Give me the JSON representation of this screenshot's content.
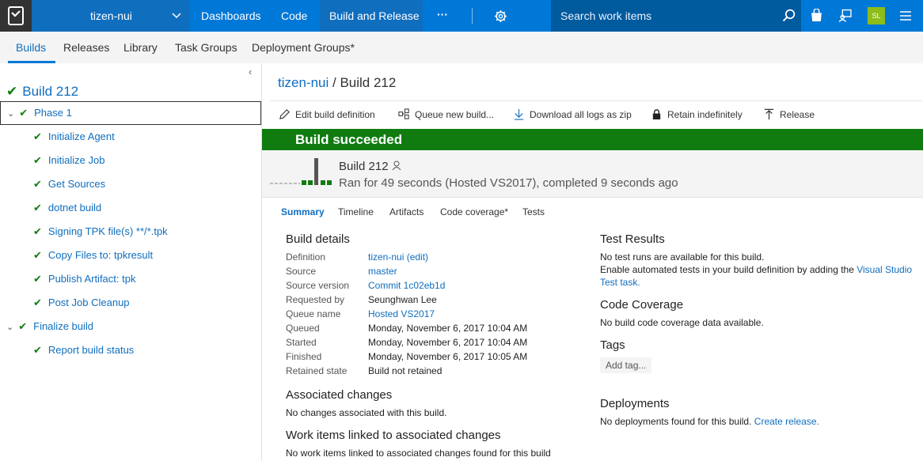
{
  "topbar": {
    "project": "tizen-nui",
    "nav": [
      "Dashboards",
      "Code",
      "Build and Release"
    ],
    "more": "···",
    "search_placeholder": "Search work items",
    "avatar_initials": "SL"
  },
  "hubs": [
    "Builds",
    "Releases",
    "Library",
    "Task Groups",
    "Deployment Groups*"
  ],
  "tree": {
    "root": "Build 212",
    "phase": "Phase 1",
    "steps": [
      "Initialize Agent",
      "Initialize Job",
      "Get Sources",
      "dotnet build",
      "Signing TPK file(s) **/*.tpk",
      "Copy Files to: tpkresult",
      "Publish Artifact: tpk",
      "Post Job Cleanup"
    ],
    "finalize": "Finalize build",
    "final_steps": [
      "Report build status"
    ]
  },
  "breadcrumb": {
    "project": "tizen-nui",
    "sep": " / ",
    "build": "Build 212"
  },
  "toolbar": [
    "Edit build definition",
    "Queue new build...",
    "Download all logs as zip",
    "Retain indefinitely",
    "Release"
  ],
  "banner": "Build succeeded",
  "summary": {
    "build": "Build 212",
    "meta": "Ran for 49 seconds (Hosted VS2017), completed 9 seconds ago"
  },
  "tabs": [
    "Summary",
    "Timeline",
    "Artifacts",
    "Code coverage*",
    "Tests"
  ],
  "build_details": {
    "title": "Build details",
    "rows": [
      {
        "label": "Definition",
        "value": "tizen-nui (edit)"
      },
      {
        "label": "Source",
        "value": "master"
      },
      {
        "label": "Source version",
        "value": "Commit 1c02eb1d"
      },
      {
        "label": "Requested by",
        "value": "Seunghwan Lee"
      },
      {
        "label": "Queue name",
        "value": "Hosted VS2017"
      },
      {
        "label": "Queued",
        "value": "Monday, November 6, 2017 10:04 AM"
      },
      {
        "label": "Started",
        "value": "Monday, November 6, 2017 10:04 AM"
      },
      {
        "label": "Finished",
        "value": "Monday, November 6, 2017 10:05 AM"
      },
      {
        "label": "Retained state",
        "value": "Build not retained"
      }
    ]
  },
  "associated_changes": {
    "title": "Associated changes",
    "text": "No changes associated with this build."
  },
  "work_items": {
    "title": "Work items linked to associated changes",
    "text": "No work items linked to associated changes found for this build"
  },
  "test_results": {
    "title": "Test Results",
    "line1": "No test runs are available for this build.",
    "line2_prefix": "Enable automated tests in your build definition by adding the ",
    "line2_link1": "Visual Studio",
    "line3_link": "Test task",
    "line3_suffix": "."
  },
  "code_coverage": {
    "title": "Code Coverage",
    "text": "No build code coverage data available."
  },
  "tags": {
    "title": "Tags",
    "add": "Add tag..."
  },
  "deployments": {
    "title": "Deployments",
    "text": "No deployments found for this build. ",
    "link": "Create release",
    "suffix": "."
  },
  "colors": {
    "accent": "#0078d7",
    "success": "#107c10",
    "link": "#106ebe"
  }
}
